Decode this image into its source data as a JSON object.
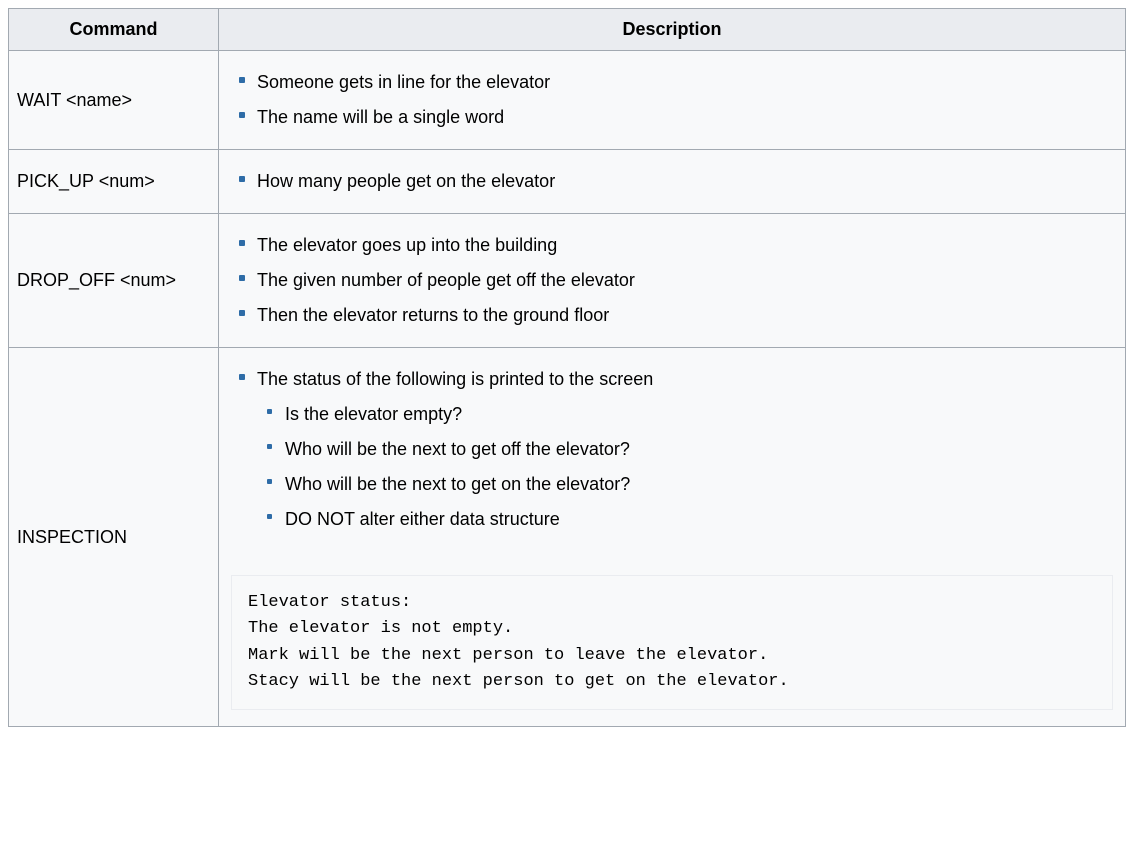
{
  "headers": {
    "command": "Command",
    "description": "Description"
  },
  "rows": {
    "wait": {
      "command": "WAIT <name>",
      "items": [
        "Someone gets in line for the elevator",
        "The name will be a single word"
      ]
    },
    "pick_up": {
      "command": "PICK_UP <num>",
      "items": [
        "How many people get on the elevator"
      ]
    },
    "drop_off": {
      "command": "DROP_OFF <num>",
      "items": [
        "The elevator goes up into the building",
        "The given number of people get off the elevator",
        "Then the elevator returns to the ground floor"
      ]
    },
    "inspection": {
      "command": "INSPECTION",
      "items": [
        "The status of the following is printed to the screen"
      ],
      "subitems": [
        "Is the elevator empty?",
        "Who will be the next to get off the elevator?",
        "Who will be the next to get on the elevator?",
        "DO NOT alter either data structure"
      ],
      "code": "Elevator status:\nThe elevator is not empty.\nMark will be the next person to leave the elevator.\nStacy will be the next person to get on the elevator."
    }
  }
}
